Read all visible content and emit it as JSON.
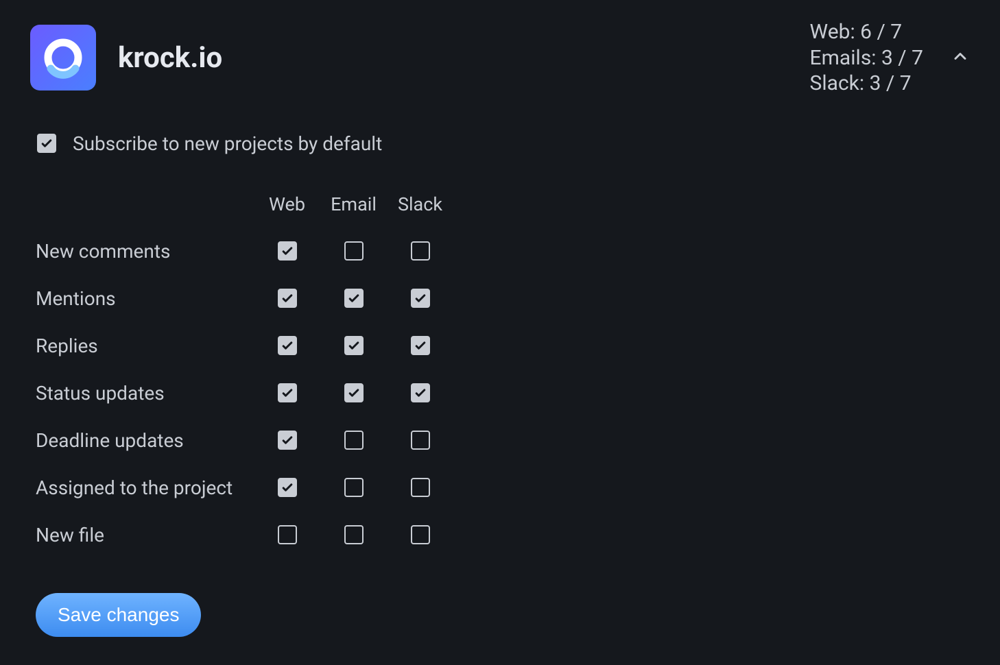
{
  "brand": {
    "name": "krock.io"
  },
  "summary": {
    "web": "Web: 6 / 7",
    "emails": "Emails: 3 / 7",
    "slack": "Slack: 3 / 7"
  },
  "subscribe": {
    "label": "Subscribe to new projects by default",
    "checked": true
  },
  "columns": [
    "Web",
    "Email",
    "Slack"
  ],
  "rows": [
    {
      "label": "New comments",
      "web": true,
      "email": false,
      "slack": false
    },
    {
      "label": "Mentions",
      "web": true,
      "email": true,
      "slack": true
    },
    {
      "label": "Replies",
      "web": true,
      "email": true,
      "slack": true
    },
    {
      "label": "Status updates",
      "web": true,
      "email": true,
      "slack": true
    },
    {
      "label": "Deadline updates",
      "web": true,
      "email": false,
      "slack": false
    },
    {
      "label": "Assigned to the project",
      "web": true,
      "email": false,
      "slack": false
    },
    {
      "label": "New file",
      "web": false,
      "email": false,
      "slack": false
    }
  ],
  "actions": {
    "save": "Save changes"
  }
}
